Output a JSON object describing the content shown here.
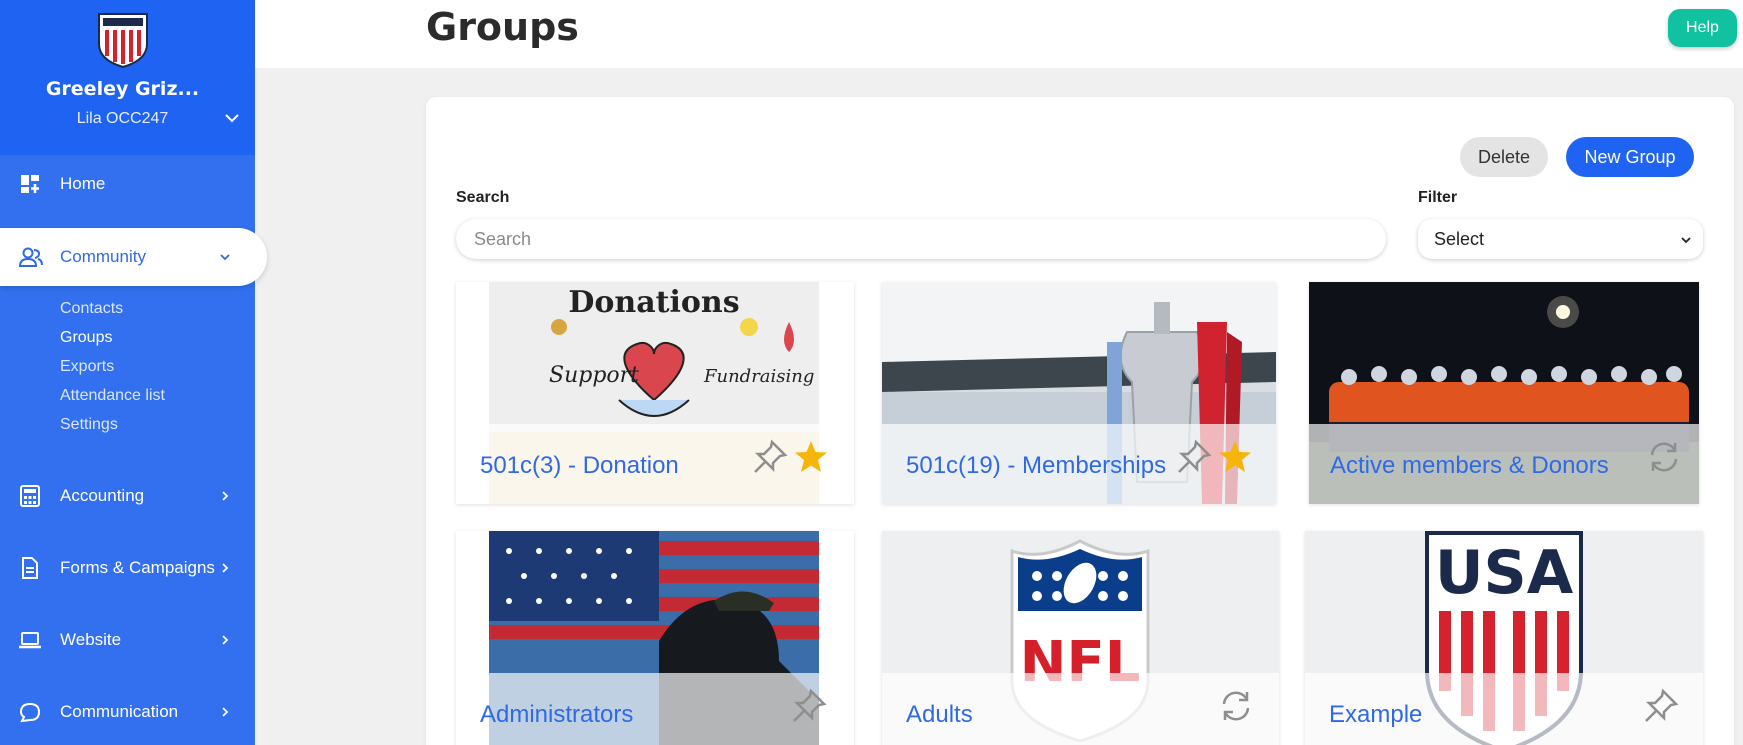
{
  "sidebar": {
    "org_name": "Greeley Griz...",
    "user_name": "Lila OCC247",
    "nav": {
      "home": "Home",
      "community": "Community",
      "accounting": "Accounting",
      "forms": "Forms & Campaigns",
      "website": "Website",
      "communication": "Communication"
    },
    "community_sub": [
      "Contacts",
      "Groups",
      "Exports",
      "Attendance list",
      "Settings"
    ]
  },
  "header": {
    "title": "Groups",
    "help_label": "Help"
  },
  "toolbar": {
    "delete_label": "Delete",
    "new_group_label": "New Group",
    "search_label": "Search",
    "search_placeholder": "Search",
    "filter_label": "Filter",
    "filter_value": "Select"
  },
  "groups": [
    {
      "name": "501c(3) - Donation",
      "pinned": true,
      "starred": true,
      "synced": false
    },
    {
      "name": "501c(19) - Memberships",
      "pinned": true,
      "starred": true,
      "synced": false
    },
    {
      "name": "Active members & Donors",
      "pinned": false,
      "starred": false,
      "synced": true
    },
    {
      "name": "Administrators",
      "pinned": true,
      "starred": false,
      "synced": false
    },
    {
      "name": "Adults",
      "pinned": false,
      "starred": false,
      "synced": true
    },
    {
      "name": "Example",
      "pinned": true,
      "starred": false,
      "synced": false
    }
  ],
  "image_text": {
    "donations": "Donations",
    "support": "Support",
    "fundraising": "Fundraising",
    "nfl": "NFL",
    "usa": "USA"
  },
  "colors": {
    "sidebar": "#3270f0",
    "sidebar_top": "#1f63f2",
    "accent": "#1f63f2",
    "help": "#11c2a0",
    "link": "#2f6ae6",
    "star": "#f5b50a"
  }
}
